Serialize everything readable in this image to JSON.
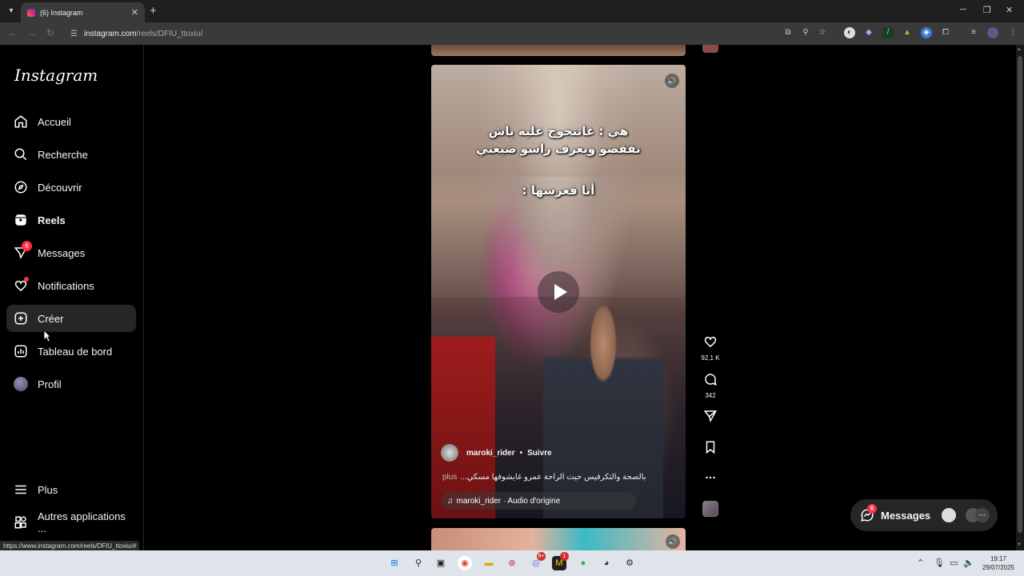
{
  "browser": {
    "tab_title": "(6) Instagram",
    "url_host": "instagram.com",
    "url_path": "/reels/DFIU_ttoxiu/",
    "status_url": "https://www.instagram.com/reels/DFIU_ttoxiu/#"
  },
  "sidebar": {
    "logo": "Instagram",
    "items": [
      {
        "label": "Accueil",
        "icon": "home-icon"
      },
      {
        "label": "Recherche",
        "icon": "search-icon"
      },
      {
        "label": "Découvrir",
        "icon": "compass-icon"
      },
      {
        "label": "Reels",
        "icon": "reels-icon"
      },
      {
        "label": "Messages",
        "icon": "messenger-icon",
        "badge": "6"
      },
      {
        "label": "Notifications",
        "icon": "heart-icon"
      },
      {
        "label": "Créer",
        "icon": "plus-square-icon"
      },
      {
        "label": "Tableau de bord",
        "icon": "dashboard-icon"
      },
      {
        "label": "Profil",
        "icon": "avatar"
      }
    ],
    "bottom": [
      {
        "label": "Plus",
        "icon": "menu-icon"
      },
      {
        "label": "Autres applications ...",
        "icon": "apps-icon"
      }
    ]
  },
  "reel": {
    "overlay_line1": "هي : غانتجوج عليه باش",
    "overlay_line2": "نفقصو ويعرف راسو ضيعني",
    "overlay_line3": "أنا فعرسها :",
    "author": "maroki_rider",
    "separator": "•",
    "follow": "Suivre",
    "caption": "بالصحة والتكرفيس حيت الراحة عمرو غايشوفها مسكي...",
    "caption_more": "plus",
    "audio": "maroki_rider · Audio d'origine"
  },
  "actions": {
    "likes": "92,1 K",
    "comments": "342"
  },
  "messages_pill": {
    "label": "Messages",
    "badge": "6"
  },
  "taskbar": {
    "discord_badge": "9+",
    "app_badge": "1",
    "time": "19:17",
    "date": "29/07/2025"
  }
}
